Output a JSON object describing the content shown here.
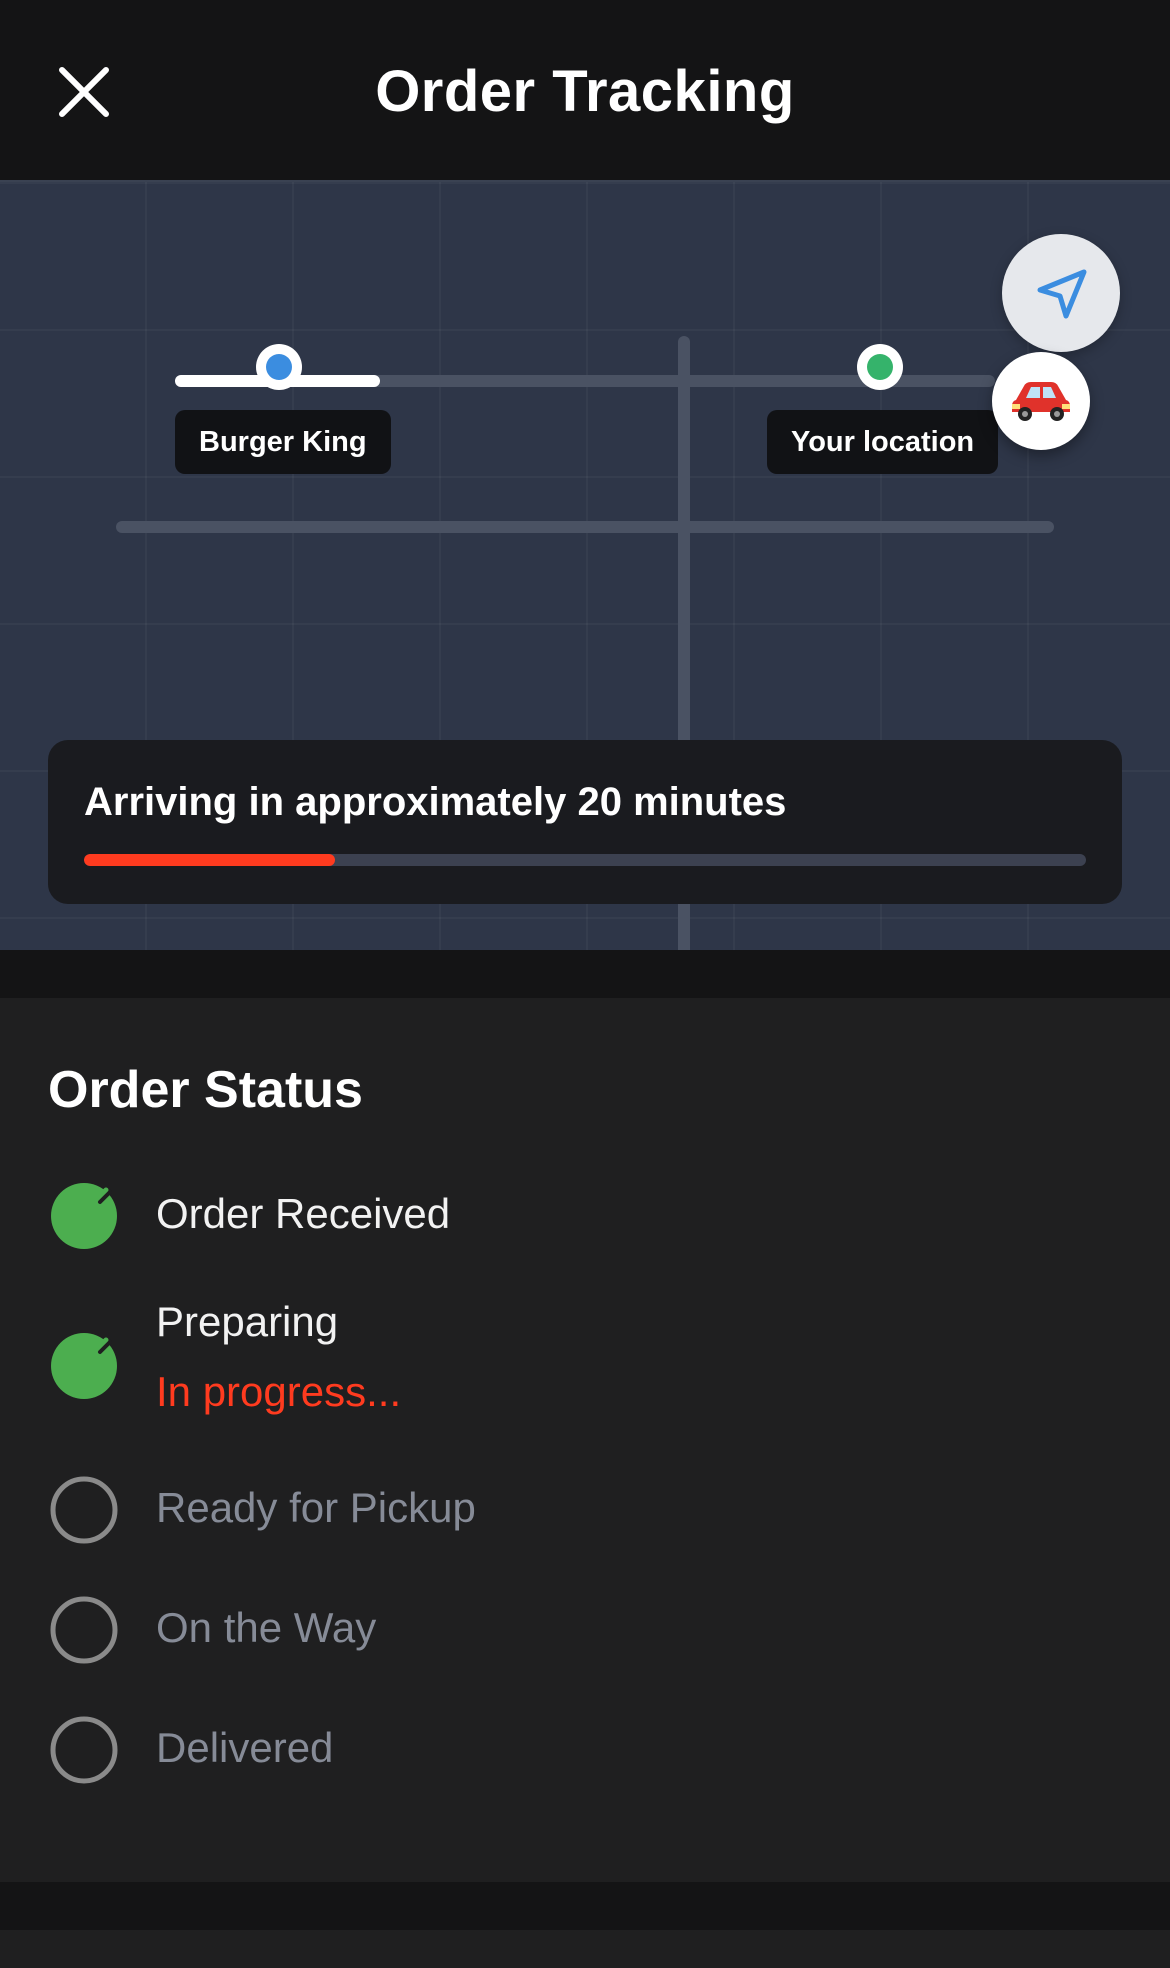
{
  "header": {
    "title": "Order Tracking",
    "close_icon": "close-icon"
  },
  "map": {
    "restaurant_label": "Burger King",
    "destination_label": "Your location",
    "restaurant_pin_color": "#3b8de0",
    "destination_pin_color": "#35b36b",
    "navigate_icon": "navigation-arrow-icon",
    "vehicle_icon": "car-icon"
  },
  "eta": {
    "text": "Arriving in approximately 20 minutes",
    "progress_percent": 25,
    "progress_color": "#ff3b1f"
  },
  "status": {
    "title": "Order Status",
    "steps": [
      {
        "label": "Order Received",
        "state": "complete"
      },
      {
        "label": "Preparing",
        "state": "complete",
        "sub": "In progress..."
      },
      {
        "label": "Ready for Pickup",
        "state": "pending"
      },
      {
        "label": "On the Way",
        "state": "pending"
      },
      {
        "label": "Delivered",
        "state": "pending"
      }
    ],
    "complete_color": "#4cae4f",
    "pending_color": "#8a8a8a"
  }
}
